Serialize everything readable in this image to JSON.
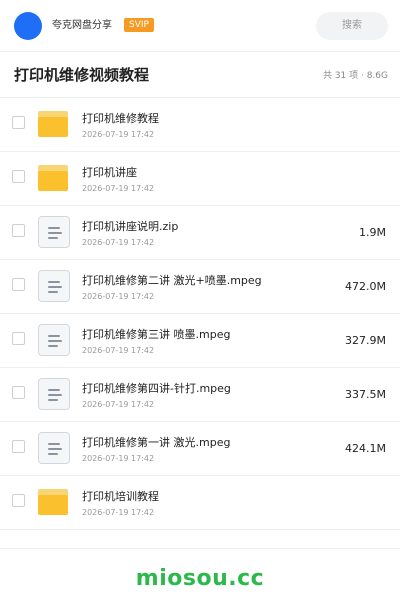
{
  "header": {
    "username": "夸克网盘分享",
    "badge": "SVIP",
    "search_label": "搜索"
  },
  "folder": {
    "title": "打印机维修视频教程",
    "meta": "共 31 项 · 8.6G"
  },
  "files": [
    {
      "type": "folder",
      "icon": "folder-icon",
      "name": "打印机维修教程",
      "date": "2026-07-19 17:42",
      "size": ""
    },
    {
      "type": "folder",
      "icon": "folder-icon",
      "name": "打印机讲座",
      "date": "2026-07-19 17:42",
      "size": ""
    },
    {
      "type": "file",
      "icon": "file-icon",
      "name": "打印机讲座说明.zip",
      "date": "2026-07-19 17:42",
      "size": "1.9M"
    },
    {
      "type": "file",
      "icon": "file-icon",
      "name": "打印机维修第二讲 激光+喷墨.mpeg",
      "date": "2026-07-19 17:42",
      "size": "472.0M"
    },
    {
      "type": "file",
      "icon": "file-icon",
      "name": "打印机维修第三讲 喷墨.mpeg",
      "date": "2026-07-19 17:42",
      "size": "327.9M"
    },
    {
      "type": "file",
      "icon": "file-icon",
      "name": "打印机维修第四讲-针打.mpeg",
      "date": "2026-07-19 17:42",
      "size": "337.5M"
    },
    {
      "type": "file",
      "icon": "file-icon",
      "name": "打印机维修第一讲 激光.mpeg",
      "date": "2026-07-19 17:42",
      "size": "424.1M"
    },
    {
      "type": "folder",
      "icon": "folder-icon",
      "name": "打印机培训教程",
      "date": "2026-07-19 17:42",
      "size": ""
    }
  ],
  "footer": {
    "watermark": "miosou.cc"
  },
  "colors": {
    "avatar": "#1e6ff5",
    "badge": "#f59a23",
    "folder": "#fbc02d",
    "watermark": "#2db84c"
  }
}
